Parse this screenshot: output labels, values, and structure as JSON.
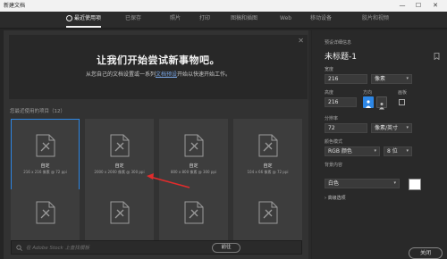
{
  "window": {
    "title": "新建文档",
    "minimize": "—",
    "maximize": "☐",
    "close": "✕"
  },
  "tabs": [
    {
      "label": "最近使用项"
    },
    {
      "label": "已保存"
    },
    {
      "label": "照片"
    },
    {
      "label": "打印"
    },
    {
      "label": "图稿和插图"
    },
    {
      "label": "Web"
    },
    {
      "label": "移动设备"
    },
    {
      "label": "胶片和视频"
    }
  ],
  "hero": {
    "heading": "让我们开始尝试新事物吧。",
    "sub_before": "从您自己的文档设置或一系列",
    "sub_link": "文档预设",
    "sub_after": "开始以快速开始工作。",
    "close": "✕"
  },
  "recent": {
    "label": "您最近使用的项目（12）",
    "tiles": [
      {
        "name": "自定",
        "info": "216 x 216 像素 @ 72 ppi"
      },
      {
        "name": "自定",
        "info": "2000 x 2000 像素 @ 300 ppi"
      },
      {
        "name": "自定",
        "info": "800 x 800 像素 @ 300 ppi"
      },
      {
        "name": "自定",
        "info": "104 x 66 像素 @ 72 ppi"
      },
      {
        "name": "",
        "info": ""
      },
      {
        "name": "",
        "info": ""
      },
      {
        "name": "",
        "info": ""
      },
      {
        "name": "",
        "info": ""
      }
    ]
  },
  "search": {
    "placeholder": "在 Adobe Stock 上查找模板",
    "button": "前往"
  },
  "details": {
    "section": "预设详细信息",
    "doc_title": "未标题-1",
    "width_label": "宽度",
    "width_value": "216",
    "width_unit": "像素",
    "height_label": "高度",
    "height_value": "216",
    "orientation_label": "方向",
    "artboard_label": "画板",
    "resolution_label": "分辨率",
    "resolution_value": "72",
    "resolution_unit": "像素/英寸",
    "color_mode_label": "颜色模式",
    "color_mode_value": "RGB 颜色",
    "bit_depth": "8 位",
    "background_label": "背景内容",
    "background_value": "白色",
    "advanced": "高级选项",
    "close_button": "关闭"
  },
  "colors": {
    "accent": "#2d87e6",
    "annotation": "#e22c2c"
  }
}
